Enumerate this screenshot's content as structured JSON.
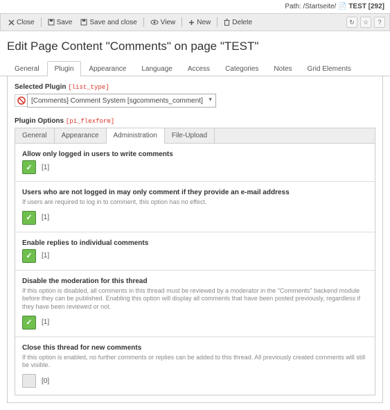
{
  "path": {
    "prefix": "Path:",
    "crumb": "/Startseite/",
    "page": "TEST [292]"
  },
  "toolbar": {
    "close": "Close",
    "save": "Save",
    "save_close": "Save and close",
    "view": "View",
    "new": "New",
    "delete": "Delete"
  },
  "heading": "Edit Page Content \"Comments\" on page \"TEST\"",
  "main_tabs": [
    "General",
    "Plugin",
    "Appearance",
    "Language",
    "Access",
    "Categories",
    "Notes",
    "Grid Elements"
  ],
  "main_active": 1,
  "selected_plugin": {
    "label": "Selected Plugin",
    "hint": "[list_type]",
    "value": "[Comments] Comment System [sgcomments_comment]"
  },
  "plugin_options": {
    "label": "Plugin Options",
    "hint": "[pi_flexform]",
    "tabs": [
      "General",
      "Appearance",
      "Administration",
      "File-Upload"
    ],
    "active": 2,
    "options": [
      {
        "title": "Allow only logged in users to write comments",
        "desc": "",
        "checked": true,
        "val": "[1]"
      },
      {
        "title": "Users who are not logged in may only comment if they provide an e-mail address",
        "desc": "If users are required to log in to comment, this option has no effect.",
        "checked": true,
        "val": "[1]"
      },
      {
        "title": "Enable replies to individual comments",
        "desc": "",
        "checked": true,
        "val": "[1]"
      },
      {
        "title": "Disable the moderation for this thread",
        "desc": "If this option is disabled, all comments in this thread must be reviewed by a moderator in the \"Comments\" backend module before they can be published. Enabling this option will display all comments that have been posted previously, regardless if they have been reviewed or not.",
        "checked": true,
        "val": "[1]"
      },
      {
        "title": "Close this thread for new comments",
        "desc": "If this option is enabled, no further comments or replies can be added to this thread. All previously created comments will still be visible.",
        "checked": false,
        "val": "[0]"
      }
    ]
  }
}
